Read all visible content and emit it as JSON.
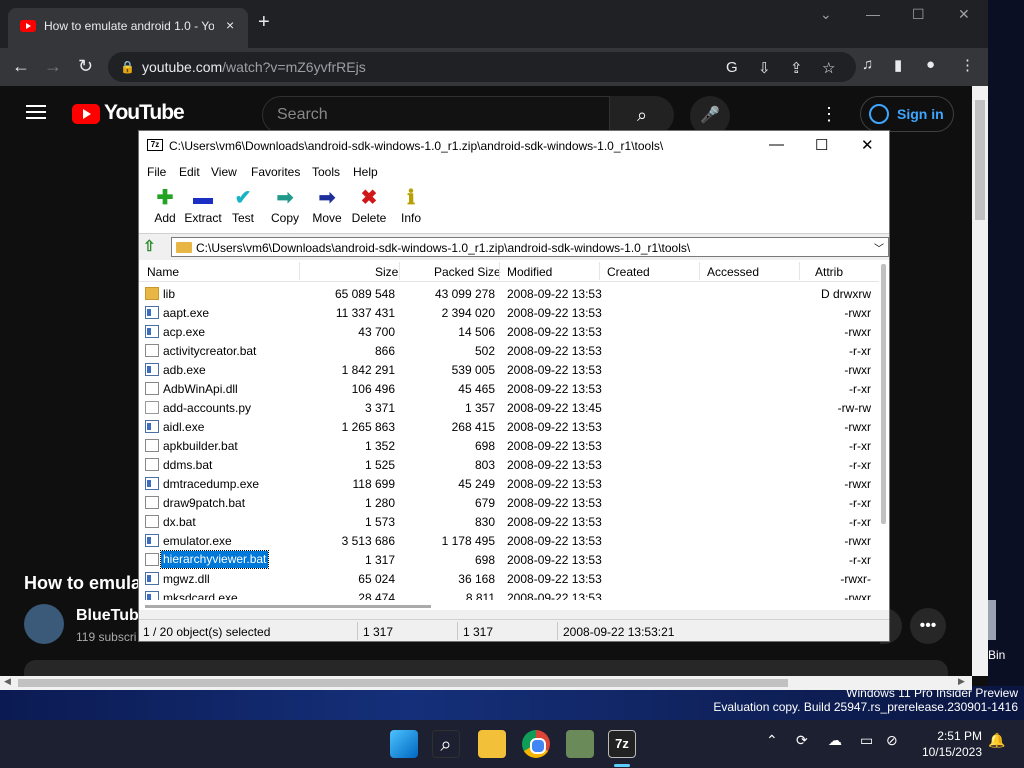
{
  "browser": {
    "tab_title": "How to emulate android 1.0 - Yo",
    "tab_close": "×",
    "new_tab": "+",
    "url_main": "youtube.com",
    "url_rest": "/watch?v=mZ6yvfrREjs"
  },
  "youtube": {
    "logo_text": "YouTube",
    "search_placeholder": "Search",
    "sign_in": "Sign in",
    "video_title": "How to emula",
    "channel_name": "BlueTube",
    "subscribers": "119 subscri"
  },
  "sevenzip": {
    "title": "C:\\Users\\vm6\\Downloads\\android-sdk-windows-1.0_r1.zip\\android-sdk-windows-1.0_r1\\tools\\",
    "icon_text": "7z",
    "menu": [
      "File",
      "Edit",
      "View",
      "Favorites",
      "Tools",
      "Help"
    ],
    "toolbar": [
      {
        "label": "Add",
        "icon": "plus-icon",
        "glyph": "✚",
        "color": "#22a322"
      },
      {
        "label": "Extract",
        "icon": "minus-icon",
        "glyph": "▬",
        "color": "#1c2fc4"
      },
      {
        "label": "Test",
        "icon": "check-icon",
        "glyph": "✔",
        "color": "#18b3c4"
      },
      {
        "label": "Copy",
        "icon": "copy-arrow-icon",
        "glyph": "➡",
        "color": "#1f9a8a"
      },
      {
        "label": "Move",
        "icon": "move-arrow-icon",
        "glyph": "➡",
        "color": "#1c2f9a"
      },
      {
        "label": "Delete",
        "icon": "delete-x-icon",
        "glyph": "✖",
        "color": "#d01818"
      },
      {
        "label": "Info",
        "icon": "info-icon",
        "glyph": "ℹ",
        "color": "#b8a000"
      }
    ],
    "address": "C:\\Users\\vm6\\Downloads\\android-sdk-windows-1.0_r1.zip\\android-sdk-windows-1.0_r1\\tools\\",
    "columns": [
      "Name",
      "Size",
      "Packed Size",
      "Modified",
      "Created",
      "Accessed",
      "Attrib"
    ],
    "files": [
      {
        "name": "lib",
        "type": "folder",
        "size": "65 089 548",
        "packed": "43 099 278",
        "modified": "2008-09-22 13:53",
        "attrib": "D drwxrw"
      },
      {
        "name": "aapt.exe",
        "type": "exe",
        "size": "11 337 431",
        "packed": "2 394 020",
        "modified": "2008-09-22 13:53",
        "attrib": "-rwxr"
      },
      {
        "name": "acp.exe",
        "type": "exe",
        "size": "43 700",
        "packed": "14 506",
        "modified": "2008-09-22 13:53",
        "attrib": "-rwxr"
      },
      {
        "name": "activitycreator.bat",
        "type": "bat",
        "size": "866",
        "packed": "502",
        "modified": "2008-09-22 13:53",
        "attrib": "-r-xr"
      },
      {
        "name": "adb.exe",
        "type": "exe",
        "size": "1 842 291",
        "packed": "539 005",
        "modified": "2008-09-22 13:53",
        "attrib": "-rwxr"
      },
      {
        "name": "AdbWinApi.dll",
        "type": "bat",
        "size": "106 496",
        "packed": "45 465",
        "modified": "2008-09-22 13:53",
        "attrib": "-r-xr"
      },
      {
        "name": "add-accounts.py",
        "type": "txt",
        "size": "3 371",
        "packed": "1 357",
        "modified": "2008-09-22 13:45",
        "attrib": "-rw-rw"
      },
      {
        "name": "aidl.exe",
        "type": "exe",
        "size": "1 265 863",
        "packed": "268 415",
        "modified": "2008-09-22 13:53",
        "attrib": "-rwxr"
      },
      {
        "name": "apkbuilder.bat",
        "type": "bat",
        "size": "1 352",
        "packed": "698",
        "modified": "2008-09-22 13:53",
        "attrib": "-r-xr"
      },
      {
        "name": "ddms.bat",
        "type": "bat",
        "size": "1 525",
        "packed": "803",
        "modified": "2008-09-22 13:53",
        "attrib": "-r-xr"
      },
      {
        "name": "dmtracedump.exe",
        "type": "exe",
        "size": "118 699",
        "packed": "45 249",
        "modified": "2008-09-22 13:53",
        "attrib": "-rwxr"
      },
      {
        "name": "draw9patch.bat",
        "type": "bat",
        "size": "1 280",
        "packed": "679",
        "modified": "2008-09-22 13:53",
        "attrib": "-r-xr"
      },
      {
        "name": "dx.bat",
        "type": "bat",
        "size": "1 573",
        "packed": "830",
        "modified": "2008-09-22 13:53",
        "attrib": "-r-xr"
      },
      {
        "name": "emulator.exe",
        "type": "exe",
        "size": "3 513 686",
        "packed": "1 178 495",
        "modified": "2008-09-22 13:53",
        "attrib": "-rwxr"
      },
      {
        "name": "hierarchyviewer.bat",
        "type": "bat",
        "size": "1 317",
        "packed": "698",
        "modified": "2008-09-22 13:53",
        "attrib": "-r-xr",
        "selected": true
      },
      {
        "name": "mgwz.dll",
        "type": "exe",
        "size": "65 024",
        "packed": "36 168",
        "modified": "2008-09-22 13:53",
        "attrib": "-rwxr-"
      },
      {
        "name": "mksdcard.exe",
        "type": "exe",
        "size": "28 474",
        "packed": "8 811",
        "modified": "2008-09-22 13:53",
        "attrib": "-rwxr"
      }
    ],
    "status": {
      "selection": "1 / 20 object(s) selected",
      "size": "1 317",
      "packed": "1 317",
      "modified": "2008-09-22 13:53:21"
    }
  },
  "desktop": {
    "recycle_label": "Bin",
    "watermark_line1": "Windows 11 Pro Insider Preview",
    "watermark_line2": "Evaluation copy. Build 25947.rs_prerelease.230901-1416"
  },
  "taskbar": {
    "time": "2:51 PM",
    "date": "10/15/2023",
    "active_app_label": "7z"
  }
}
